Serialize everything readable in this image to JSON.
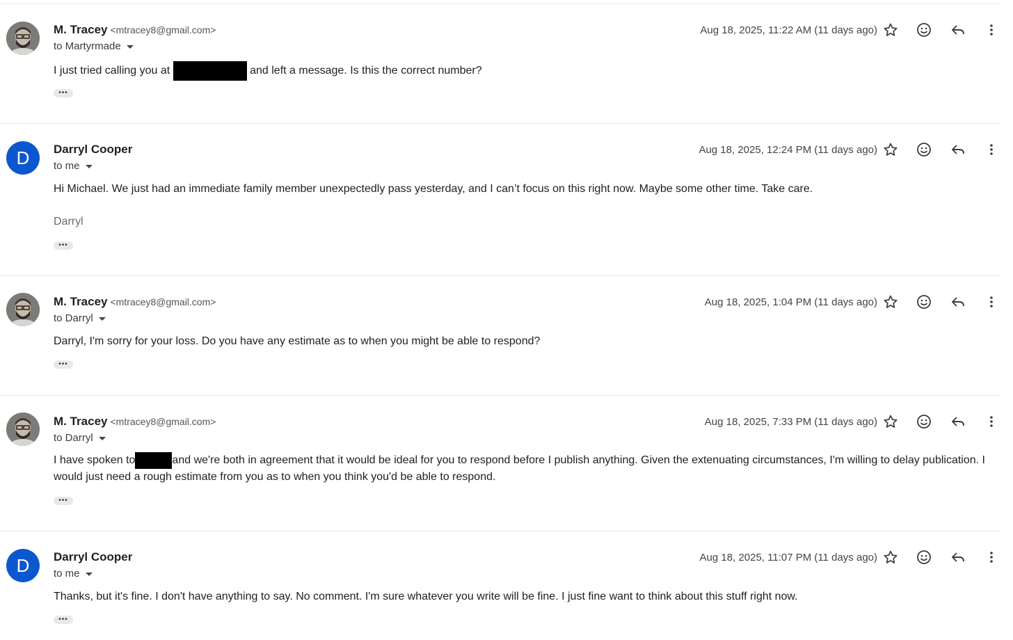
{
  "messages": [
    {
      "sender": "M. Tracey",
      "email": "<mtracey8@gmail.com>",
      "recipient": "to Martyrmade",
      "date": "Aug 18, 2025, 11:22 AM (11 days ago)",
      "body_before": "I just tried calling you at",
      "body_after": "and left a message. Is this the correct number?",
      "avatar": "photo"
    },
    {
      "sender": "Darryl Cooper",
      "recipient": "to me",
      "date": "Aug 18, 2025, 12:24 PM (11 days ago)",
      "body": "Hi Michael. We just had an immediate family member unexpectedly pass yesterday, and I can’t focus on this right now. Maybe some other time. Take care.",
      "signature": "Darryl",
      "avatar_letter": "D"
    },
    {
      "sender": "M. Tracey",
      "email": "<mtracey8@gmail.com>",
      "recipient": "to Darryl",
      "date": "Aug 18, 2025, 1:04 PM (11 days ago)",
      "body": "Darryl, I'm sorry for your loss. Do you have any estimate as to when you might be able to respond?",
      "avatar": "photo"
    },
    {
      "sender": "M. Tracey",
      "email": "<mtracey8@gmail.com>",
      "recipient": "to Darryl",
      "date": "Aug 18, 2025, 7:33 PM (11 days ago)",
      "body_before": "I have spoken to",
      "body_after": "and we're both in agreement that it would be ideal for you to respond before I publish anything. Given the extenuating circumstances, I'm willing to delay publication. I would just need a rough estimate from you as to when you think you'd be able to respond.",
      "avatar": "photo"
    },
    {
      "sender": "Darryl Cooper",
      "recipient": "to me",
      "date": "Aug 18, 2025, 11:07 PM (11 days ago)",
      "body": "Thanks, but it's fine. I don't have anything to say. No comment. I'm sure whatever you write will be fine. I just fine want to think about this stuff right now.",
      "avatar_letter": "D"
    }
  ],
  "ui": {
    "trimmed_content": "•••",
    "icons": [
      "star-icon",
      "emoji-icon",
      "reply-icon",
      "more-vert-icon"
    ]
  }
}
